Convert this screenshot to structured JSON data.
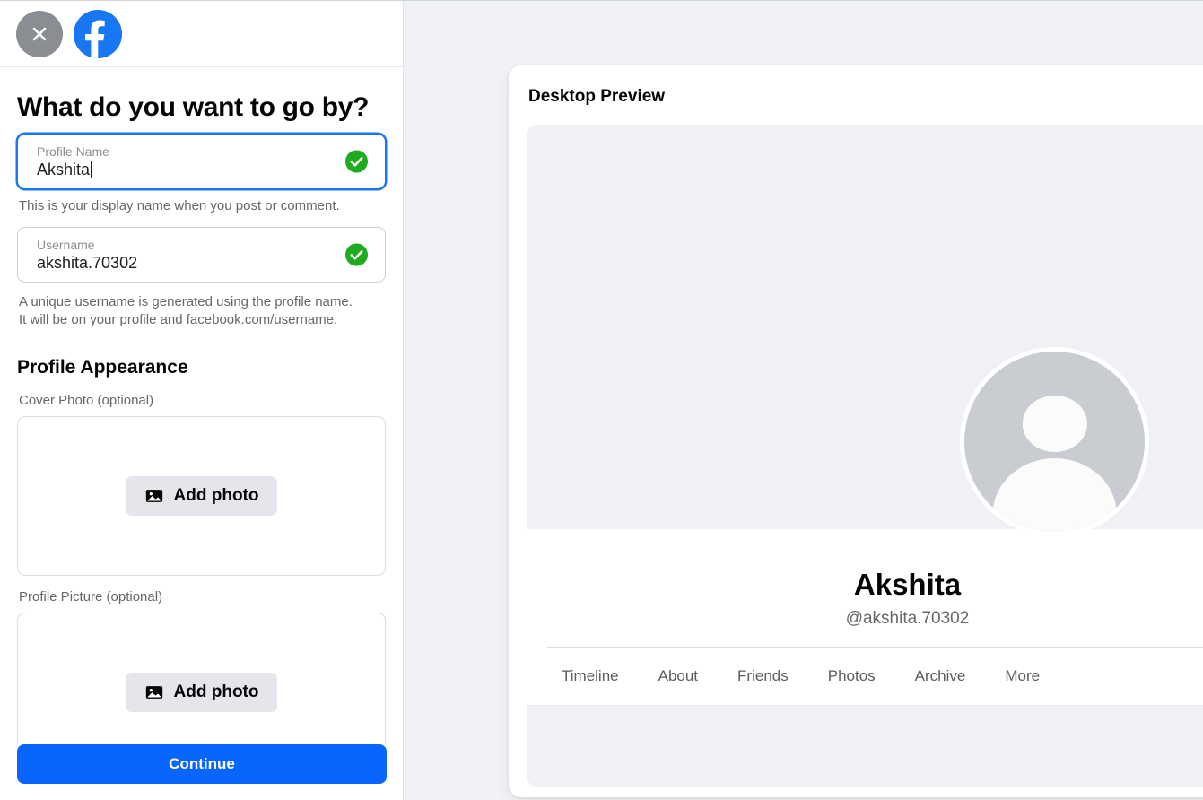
{
  "header": {
    "close_label": "Close",
    "close_icon": "close-icon",
    "brand_icon": "facebook-logo-icon",
    "brand_label": "Facebook"
  },
  "form": {
    "title": "What do you want to go by?",
    "profile_name": {
      "label": "Profile Name",
      "value": "Akshita",
      "placeholder": "Profile Name",
      "status_icon": "check-circle-icon",
      "helper": "This is your display name when you post or comment."
    },
    "username": {
      "label": "Username",
      "value": "akshita.70302",
      "placeholder": "Username",
      "status_icon": "check-circle-icon",
      "helper_line1": "A unique username is generated using the profile name.",
      "helper_line2": "It will be on your profile and facebook.com/username."
    },
    "appearance": {
      "section_title": "Profile Appearance",
      "cover_photo": {
        "label": "Cover Photo (optional)",
        "button_label": "Add photo",
        "button_icon": "image-icon"
      },
      "profile_picture": {
        "label": "Profile Picture (optional)",
        "button_label": "Add photo",
        "button_icon": "image-icon"
      }
    },
    "continue_label": "Continue"
  },
  "preview": {
    "title": "Desktop Preview",
    "display_name": "Akshita",
    "handle": "@akshita.70302",
    "avatar_icon": "person-placeholder-icon",
    "tabs": [
      {
        "label": "Timeline"
      },
      {
        "label": "About"
      },
      {
        "label": "Friends"
      },
      {
        "label": "Photos"
      },
      {
        "label": "Archive"
      },
      {
        "label": "More"
      }
    ]
  },
  "colors": {
    "brand_blue": "#1877F2",
    "primary_button": "#0866FF",
    "success_green": "#1faa1f",
    "close_gray": "#8a8d91",
    "page_bg": "#f0f2f5",
    "cover_placeholder": "#eff1f4",
    "avatar_gray": "#c9ccd1"
  }
}
